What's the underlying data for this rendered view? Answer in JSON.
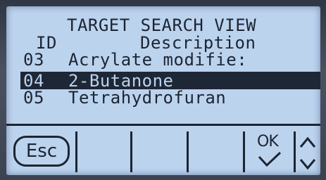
{
  "screen": {
    "title": "TARGET SEARCH VIEW",
    "header": {
      "id": "ID",
      "description": "Description"
    },
    "rows": [
      {
        "id": "03",
        "description": "Acrylate modifie:"
      },
      {
        "id": "04",
        "description": "2-Butanone"
      },
      {
        "id": "05",
        "description": "Tetrahydrofuran"
      }
    ],
    "selected_row_index": 1
  },
  "softkeys": {
    "esc": "Esc",
    "ok": "OK"
  },
  "colors": {
    "lcd_background": "#bcd3ee",
    "lcd_text": "#1c2532",
    "bezel": "#3a4250"
  }
}
